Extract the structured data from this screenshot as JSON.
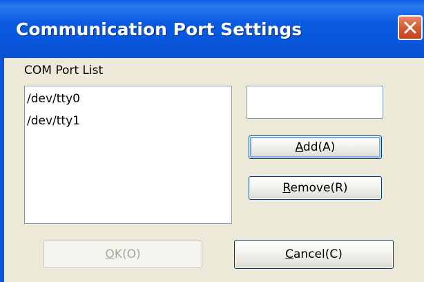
{
  "window": {
    "title": "Communication Port Settings"
  },
  "port_list": {
    "label": "COM Port List",
    "items": [
      "/dev/tty0",
      "/dev/tty1"
    ]
  },
  "port_input": {
    "value": ""
  },
  "buttons": {
    "add": "Add(A)",
    "remove": "Remove(R)",
    "ok": "OK(O)",
    "cancel": "Cancel(C)"
  },
  "icons": {
    "close": "close-icon"
  },
  "colors": {
    "titlebar": "#0a5ae0",
    "close_button": "#d45a35",
    "dialog_background": "#ece9d8",
    "disabled_text": "#a9a798"
  }
}
